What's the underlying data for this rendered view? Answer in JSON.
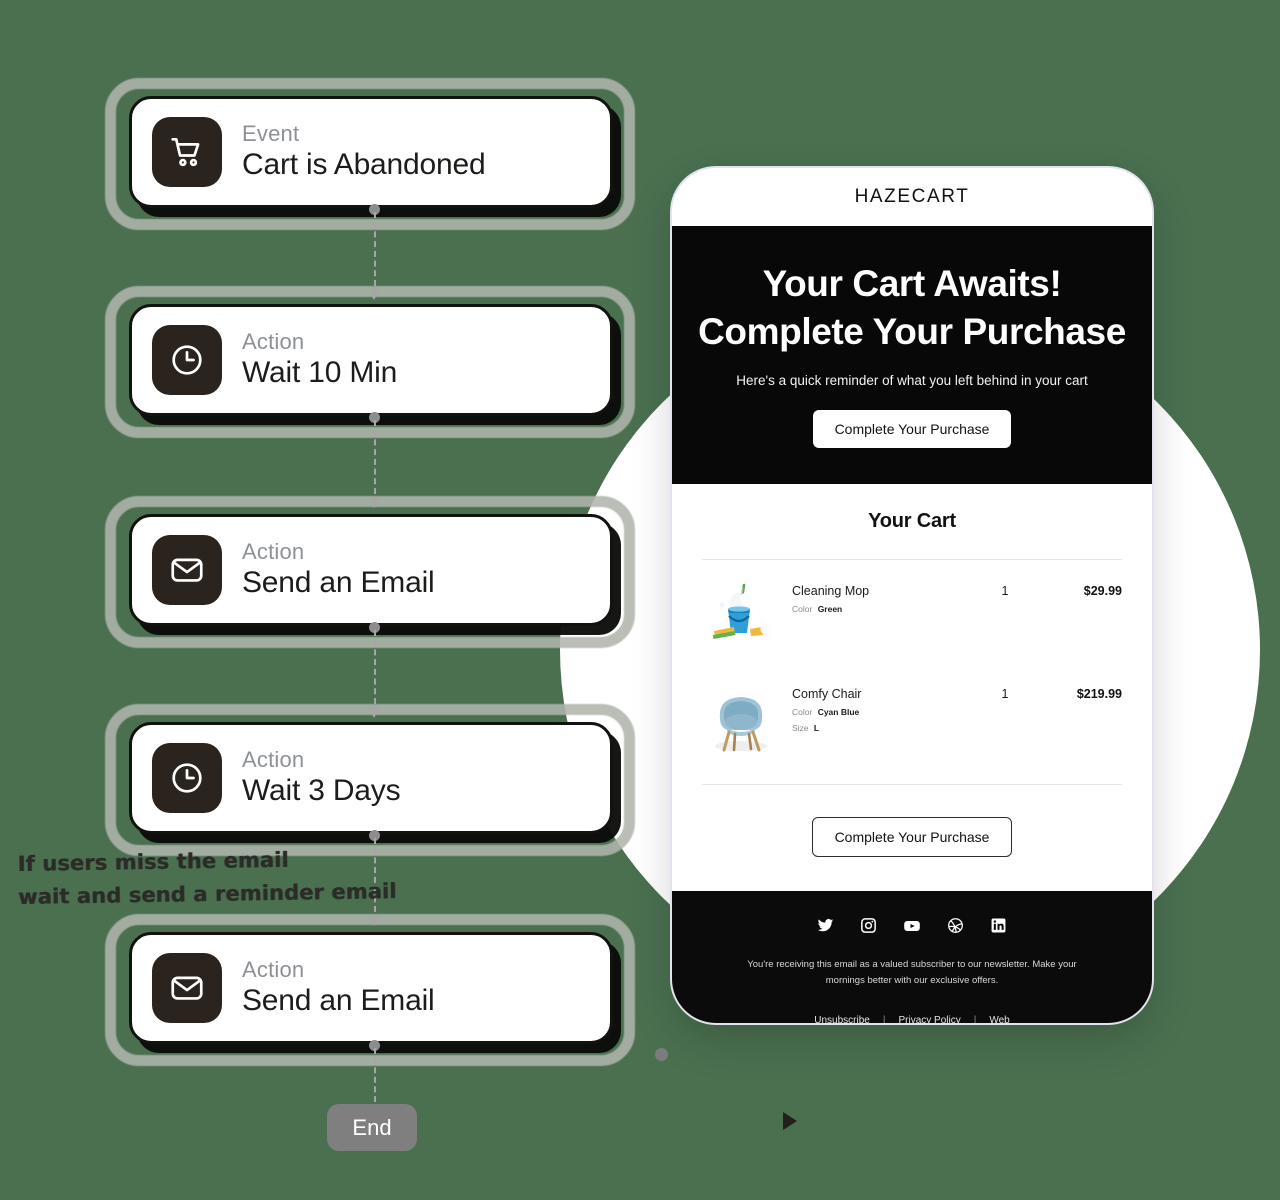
{
  "theme": {
    "background": "#4a7050",
    "node_icon_bg": "#2b241e",
    "accent_dark": "#080808",
    "connector": "#a6a6a6",
    "end_pill_bg": "#7f7f7f"
  },
  "flow": {
    "nodes": [
      {
        "kind": "Event",
        "title": "Cart is Abandoned",
        "icon": "shopping-cart-icon"
      },
      {
        "kind": "Action",
        "title": "Wait 10 Min",
        "icon": "clock-icon"
      },
      {
        "kind": "Action",
        "title": "Send an Email",
        "icon": "envelope-icon"
      },
      {
        "kind": "Action",
        "title": "Wait 3 Days",
        "icon": "clock-icon"
      },
      {
        "kind": "Action",
        "title": "Send an Email",
        "icon": "envelope-icon"
      }
    ],
    "annotation": {
      "line1": "If users miss the email",
      "line2": "wait and send a reminder email"
    },
    "end_label": "End"
  },
  "email": {
    "brand": "HAZECART",
    "hero": {
      "heading_line1": "Your Cart Awaits!",
      "heading_line2": "Complete Your Purchase",
      "subheading": "Here's a quick reminder of what you left behind in your cart",
      "cta_label": "Complete Your Purchase"
    },
    "cart": {
      "title": "Your Cart",
      "items": [
        {
          "name": "Cleaning Mop",
          "qty": "1",
          "price": "$29.99",
          "image": "cleaning-mop-bucket-image",
          "attrs": [
            {
              "label": "Color",
              "value": "Green"
            }
          ]
        },
        {
          "name": "Comfy Chair",
          "qty": "1",
          "price": "$219.99",
          "image": "blue-armchair-image",
          "attrs": [
            {
              "label": "Color",
              "value": "Cyan Blue"
            },
            {
              "label": "Size",
              "value": "L"
            }
          ]
        }
      ],
      "cta_label": "Complete Your Purchase"
    },
    "footer": {
      "socials": [
        "twitter-icon",
        "instagram-icon",
        "youtube-icon",
        "dribbble-icon",
        "linkedin-icon"
      ],
      "note": "You're receiving this email as a valued subscriber to our newsletter. Make your mornings better with our exclusive offers.",
      "links": [
        "Unsubscribe",
        "Privacy Policy",
        "Web"
      ],
      "separator": "|"
    }
  }
}
